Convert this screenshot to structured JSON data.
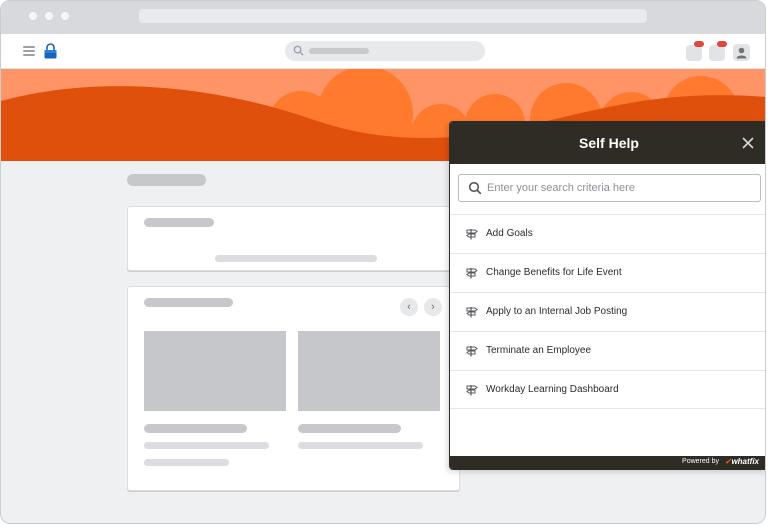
{
  "panel": {
    "title": "Self Help",
    "search_placeholder": "Enter your search criteria here",
    "items": [
      {
        "label": "Add Goals"
      },
      {
        "label": "Change Benefits for Life Event"
      },
      {
        "label": "Apply to an Internal Job Posting"
      },
      {
        "label": "Terminate an Employee"
      },
      {
        "label": "Workday Learning Dashboard"
      }
    ],
    "footer": {
      "powered_by": "Powered by",
      "brand": "whatfix"
    }
  },
  "icons": {
    "menu": "hamburger-icon",
    "search": "search-icon",
    "close": "close-icon",
    "item": "signpost-icon",
    "notification": "notification-icon",
    "user": "user-icon"
  },
  "colors": {
    "banner_light": "#ff9466",
    "banner_mid": "#ff7a2e",
    "banner_dark": "#e0500d",
    "panel_dark": "#2f2b25",
    "badge": "#e0453f",
    "logo": "#1565c0"
  }
}
